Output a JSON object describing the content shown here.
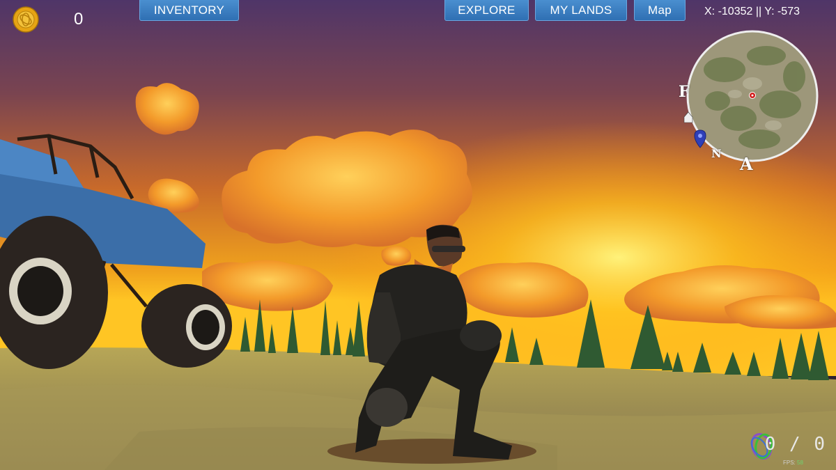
{
  "hud": {
    "coin_count": "0",
    "buttons": {
      "inventory": "INVENTORY",
      "explore": "EXPLORE",
      "my_lands": "MY LANDS",
      "map": "Map"
    },
    "coordinates": "X: -10352 || Y: -573",
    "ammo": "0 / 0",
    "fps_label": "FPS:",
    "fps_value": "58"
  },
  "minimap": {
    "letters": [
      "F",
      "N",
      "A"
    ],
    "icons": [
      "home-icon",
      "player-location-pin-icon",
      "target-marker-icon"
    ]
  },
  "colors": {
    "button": "#3a7fc4",
    "coin": "#e7a816",
    "sky_top": "#5a3a70",
    "sun": "#ffd23a",
    "ground": "#a89a55"
  }
}
